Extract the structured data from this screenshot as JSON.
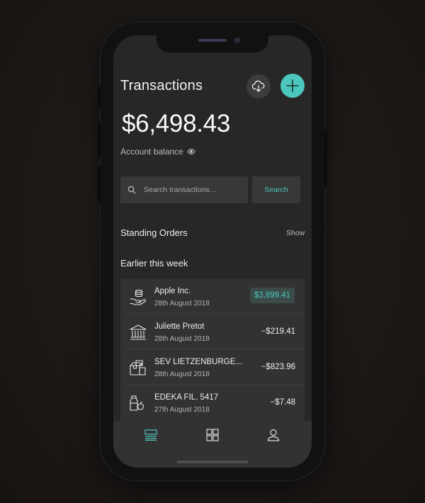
{
  "header": {
    "title": "Transactions",
    "download_icon": "cloud-download-icon",
    "add_icon": "plus-icon"
  },
  "balance": {
    "amount": "$6,498.43",
    "label": "Account balance",
    "visibility_icon": "eye-icon"
  },
  "search": {
    "placeholder": "Search transactions...",
    "button_label": "Search",
    "icon": "search-icon"
  },
  "standing_orders": {
    "title": "Standing Orders",
    "action": "Show"
  },
  "transactions_section": {
    "title": "Earlier this week"
  },
  "transactions": [
    {
      "name": "Apple Inc.",
      "date": "28th August 2018",
      "amount": "$3,899.41",
      "type": "credit",
      "icon": "hand-coins-icon"
    },
    {
      "name": "Juliette Pretot",
      "date": "28th August 2018",
      "amount": "−$219.41",
      "type": "debit",
      "icon": "bank-icon"
    },
    {
      "name": "SEV LIETZENBURGE...",
      "date": "28th August 2018",
      "amount": "−$823.96",
      "type": "debit",
      "icon": "package-icon"
    },
    {
      "name": "EDEKA FIL. 5417",
      "date": "27th August 2018",
      "amount": "−$7.48",
      "type": "debit",
      "icon": "grocery-icon"
    }
  ],
  "tabbar": {
    "tabs": [
      {
        "icon": "list-icon",
        "active": true
      },
      {
        "icon": "grid-icon",
        "active": false
      },
      {
        "icon": "user-icon",
        "active": false
      }
    ]
  },
  "colors": {
    "accent": "#4cc7bd",
    "screen_bg": "#272727",
    "card_bg": "#323232"
  }
}
